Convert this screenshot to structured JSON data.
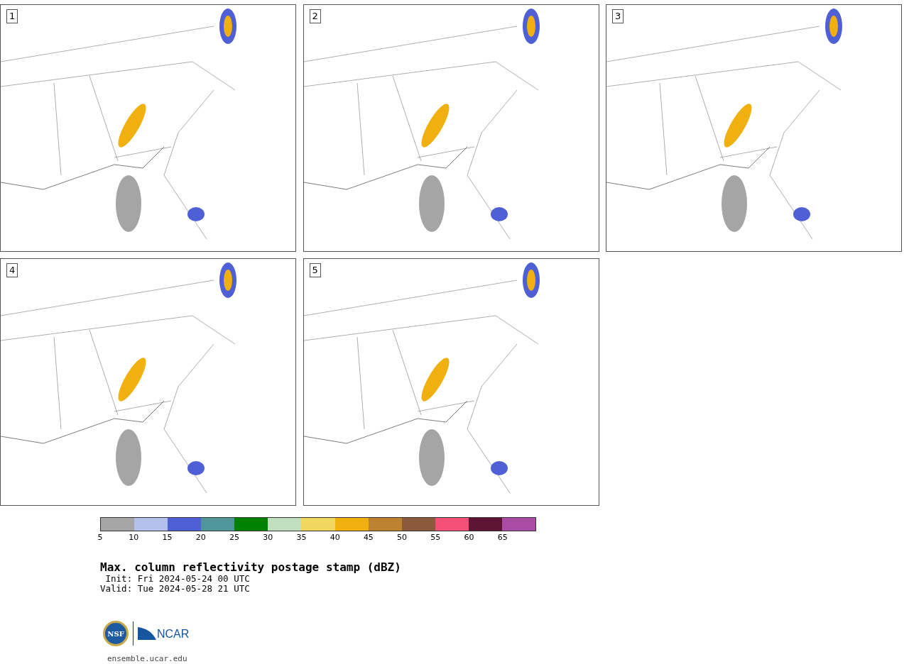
{
  "panels": [
    {
      "label": "1"
    },
    {
      "label": "2"
    },
    {
      "label": "3"
    },
    {
      "label": "4"
    },
    {
      "label": "5"
    }
  ],
  "colorbar": {
    "bins": [
      {
        "color": "#a5a5a5",
        "tick": "5"
      },
      {
        "color": "#b4c1ec",
        "tick": "10"
      },
      {
        "color": "#4f5fd6",
        "tick": "15"
      },
      {
        "color": "#4f9599",
        "tick": "20"
      },
      {
        "color": "#008000",
        "tick": "25"
      },
      {
        "color": "#bfdfbf",
        "tick": "30"
      },
      {
        "color": "#f0d860",
        "tick": "35"
      },
      {
        "color": "#f0b010",
        "tick": "40"
      },
      {
        "color": "#bc8230",
        "tick": "45"
      },
      {
        "color": "#8b5a3c",
        "tick": "50"
      },
      {
        "color": "#f55078",
        "tick": "55"
      },
      {
        "color": "#5e1535",
        "tick": "60"
      },
      {
        "color": "#aa4ca6",
        "tick": "65"
      }
    ]
  },
  "title": "Max. column reflectivity postage stamp (dBZ)",
  "init": " Init: Fri 2024-05-24 00 UTC",
  "valid": "Valid: Tue 2024-05-28 21 UTC",
  "logos": {
    "nsf": "NSF",
    "ncar": "NCAR"
  },
  "footer": "ensemble.ucar.edu"
}
